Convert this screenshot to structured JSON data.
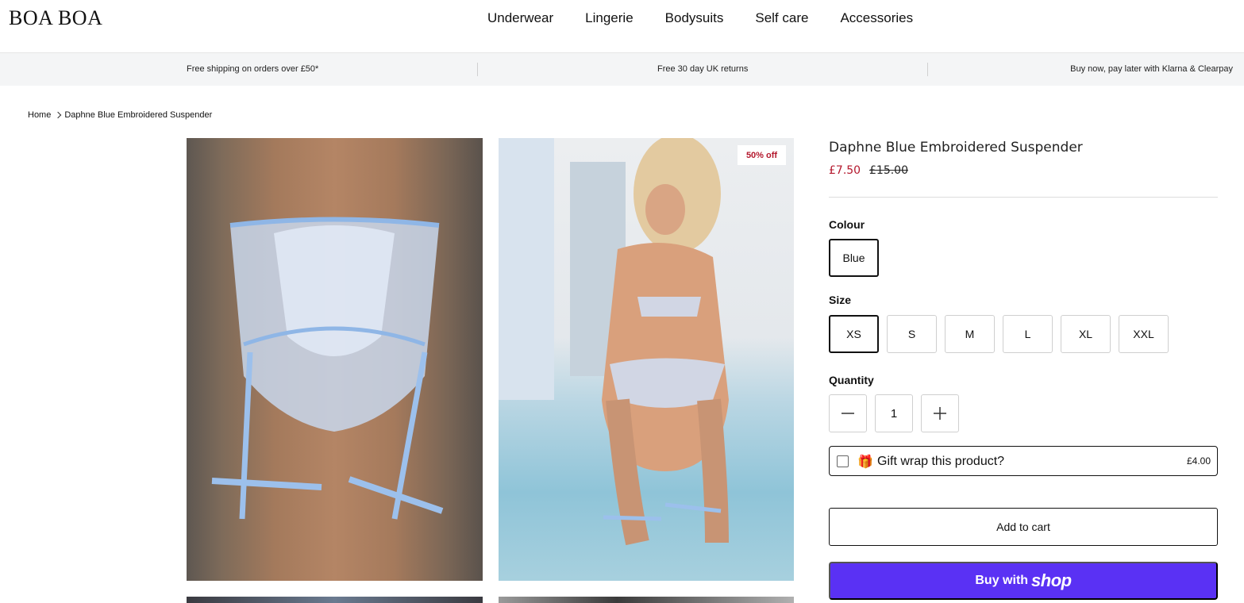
{
  "header": {
    "logo": "BOA BOA",
    "nav": [
      "Underwear",
      "Lingerie",
      "Bodysuits",
      "Self care",
      "Accessories"
    ]
  },
  "announcements": [
    "Free shipping on orders over £50*",
    "Free 30 day UK returns",
    "Buy now, pay later with Klarna & Clearpay"
  ],
  "breadcrumb": {
    "home": "Home",
    "current": "Daphne Blue Embroidered Suspender"
  },
  "gallery": {
    "badge": "50% off"
  },
  "product": {
    "title": "Daphne Blue Embroidered Suspender",
    "price": "£7.50",
    "compare_price": "£15.00",
    "colour_label": "Colour",
    "colour_selected": "Blue",
    "size_label": "Size",
    "sizes": [
      "XS",
      "S",
      "M",
      "L",
      "XL",
      "XXL"
    ],
    "size_selected": "XS",
    "quantity_label": "Quantity",
    "quantity": "1",
    "gift_label": "Gift wrap this product?",
    "gift_price": "£4.00",
    "add_to_cart": "Add to cart",
    "buy_with": "Buy with",
    "shop_brand": "shop"
  },
  "colors": {
    "sale": "#b4182d",
    "shop_pay": "#5a31f4"
  }
}
